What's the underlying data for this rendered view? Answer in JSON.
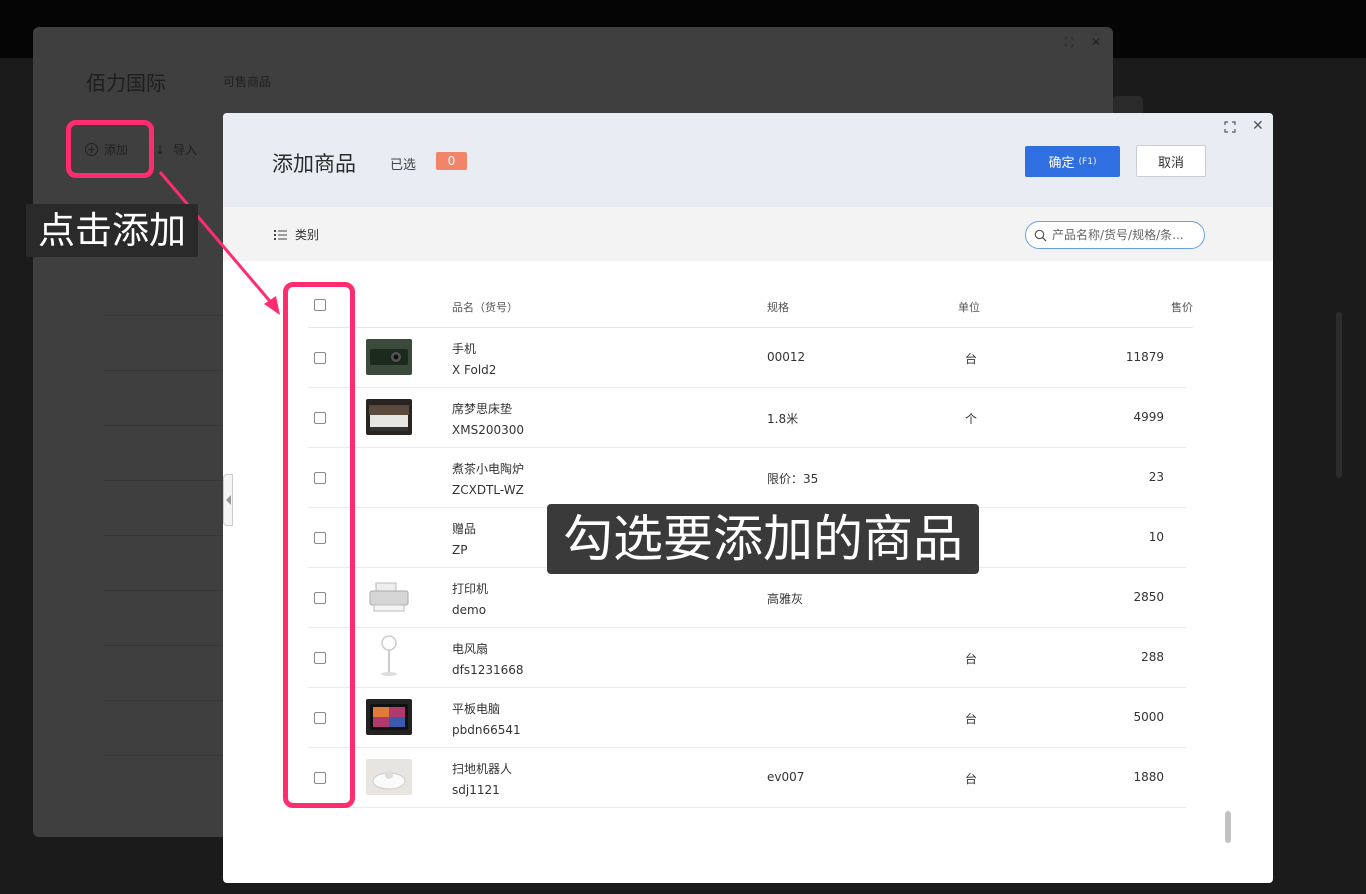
{
  "background": {
    "title": "佰力国际",
    "subtitle": "可售商品",
    "add_label": "添加",
    "import_label": "导入"
  },
  "annotations": {
    "caption_click_add": "点击添加",
    "caption_check_goods": "勾选要添加的商品"
  },
  "modal": {
    "title": "添加商品",
    "selected_label": "已选",
    "selected_count": "0",
    "confirm_label": "确定",
    "confirm_shortcut": "(F1)",
    "cancel_label": "取消",
    "category_label": "类别",
    "search_placeholder": "产品名称/货号/规格/条...",
    "columns": {
      "name": "品名（货号）",
      "spec": "规格",
      "unit": "单位",
      "price": "售价"
    },
    "rows": [
      {
        "name": "手机",
        "code": "X Fold2",
        "spec": "00012",
        "unit": "台",
        "price": "11879",
        "thumb": "phone"
      },
      {
        "name": "席梦思床垫",
        "code": "XMS200300",
        "spec": "1.8米",
        "unit": "个",
        "price": "4999",
        "thumb": "bed"
      },
      {
        "name": "煮茶小电陶炉",
        "code": "ZCXDTL-WZ",
        "spec": "限价：35",
        "unit": "",
        "price": "23",
        "thumb": ""
      },
      {
        "name": "赠品",
        "code": "ZP",
        "spec": "",
        "unit": "",
        "price": "10",
        "thumb": ""
      },
      {
        "name": "打印机",
        "code": "demo",
        "spec": "高雅灰",
        "unit": "",
        "price": "2850",
        "thumb": "printer"
      },
      {
        "name": "电风扇",
        "code": "dfs1231668",
        "spec": "",
        "unit": "台",
        "price": "288",
        "thumb": "fan"
      },
      {
        "name": "平板电脑",
        "code": "pbdn66541",
        "spec": "",
        "unit": "台",
        "price": "5000",
        "thumb": "tablet"
      },
      {
        "name": "扫地机器人",
        "code": "sdj1121",
        "spec": "ev007",
        "unit": "台",
        "price": "1880",
        "thumb": "robot"
      }
    ]
  },
  "colors": {
    "accent": "#2f6fe0",
    "badge": "#f1856a",
    "highlight": "#ff2d6f"
  }
}
